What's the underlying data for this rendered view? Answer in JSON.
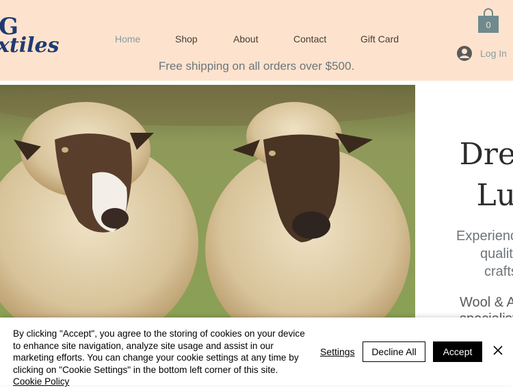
{
  "logo": {
    "line1": "G",
    "line2": "xtiles"
  },
  "nav": {
    "items": [
      "Home",
      "Shop",
      "About",
      "Contact",
      "Gift Card"
    ],
    "active": "Home"
  },
  "promo": "Free shipping on all orders over $500.",
  "cart": {
    "count": "0",
    "icon": "shopping-bag-icon",
    "color": "#6e8a8f"
  },
  "login": {
    "label": "Log In",
    "icon": "user-avatar-icon"
  },
  "hero": {
    "image": "two-sheep-photo",
    "title": "Dre\nLu",
    "subtitle": [
      "Experience",
      "quality",
      "craftsi"
    ],
    "subtitle2": [
      "Wool & A",
      "specialists"
    ]
  },
  "cookie": {
    "text": "By clicking \"Accept\", you agree to the storing of cookies on your device to enhance site navigation, analyze site usage and assist in our marketing efforts. You can change your cookie settings at any time by clicking on \"Cookie Settings\" in the bottom left corner of this site.",
    "policy_link": "Cookie Policy",
    "settings": "Settings",
    "decline": "Decline All",
    "accept": "Accept"
  },
  "colors": {
    "header_bg": "#fde3ce",
    "logo": "#1e3a72",
    "accept_bg": "#000000"
  }
}
